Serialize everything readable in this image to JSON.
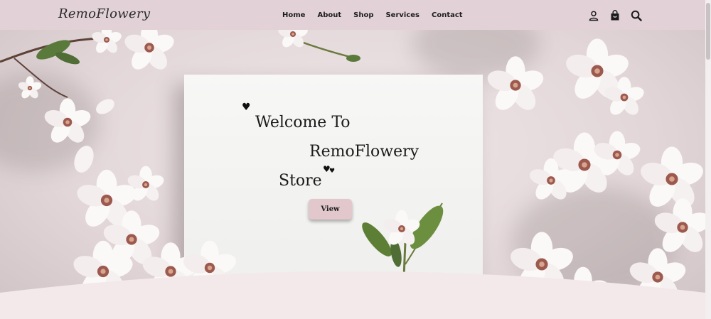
{
  "header": {
    "logo": "RemoFlowery",
    "nav": [
      {
        "label": "Home"
      },
      {
        "label": "About"
      },
      {
        "label": "Shop"
      },
      {
        "label": "Services"
      },
      {
        "label": "Contact"
      }
    ],
    "icons": [
      "user-icon",
      "shopping-bag-icon",
      "search-icon"
    ]
  },
  "hero": {
    "line1": "Welcome To",
    "line2": "RemoFlowery",
    "line3": "Store",
    "button_label": "View"
  },
  "colors": {
    "header_bg": "#e2d2d7",
    "button_bg": "#e2c8cd",
    "background": "#e8dde0"
  }
}
